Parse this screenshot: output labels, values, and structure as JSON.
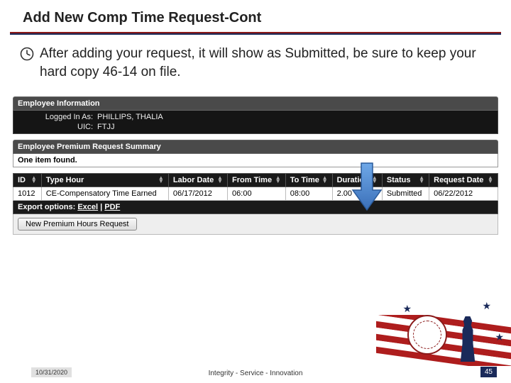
{
  "title": "Add New Comp Time Request-Cont",
  "body_text": "After adding your request, it will show as Submitted, be sure to keep your hard copy 46-14 on file.",
  "employee_info": {
    "header": "Employee Information",
    "logged_in_label": "Logged In As:",
    "logged_in_value": "PHILLIPS, THALIA",
    "uic_label": "UIC:",
    "uic_value": "FTJJ"
  },
  "summary": {
    "header": "Employee Premium Request Summary",
    "count_text": "One item found."
  },
  "table": {
    "columns": [
      "ID",
      "Type Hour",
      "Labor Date",
      "From Time",
      "To Time",
      "Duration",
      "Status",
      "Request Date"
    ],
    "rows": [
      {
        "id": "1012",
        "type_hour": "CE-Compensatory Time Earned",
        "labor_date": "06/17/2012",
        "from_time": "06:00",
        "to_time": "08:00",
        "duration": "2.00",
        "status": "Submitted",
        "request_date": "06/22/2012"
      }
    ]
  },
  "export": {
    "label": "Export options:",
    "excel": "Excel",
    "sep": " | ",
    "pdf": "PDF"
  },
  "new_button": "New Premium Hours Request",
  "footer": {
    "date": "10/31/2020",
    "motto": "Integrity - Service - Innovation",
    "page": "45"
  },
  "colors": {
    "accent_red": "#8b1a1a",
    "accent_navy": "#1a2a5a"
  }
}
